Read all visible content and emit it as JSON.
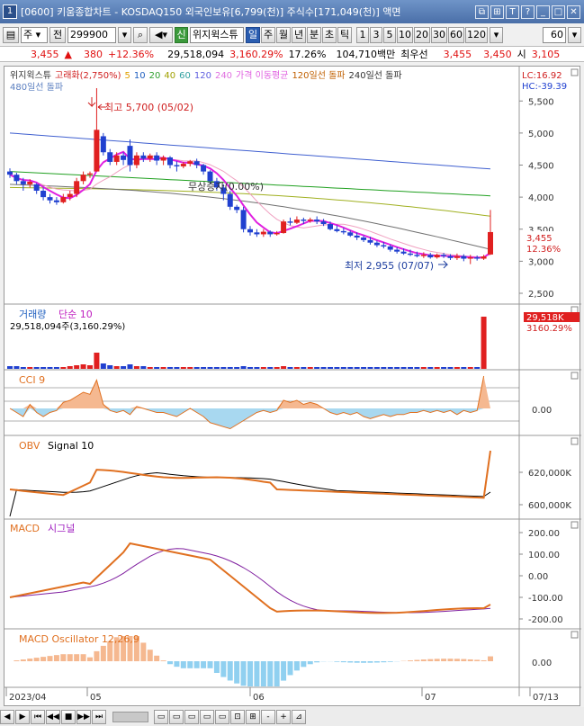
{
  "window": {
    "number": "1",
    "title": "[0600] 키움종합차트 - KOSDAQ150 외국인보유[6,799(천)] 주식수[171,049(천)] 액면",
    "buttons": [
      "⧉",
      "⊞",
      "T",
      "?",
      "_",
      "□",
      "✕"
    ]
  },
  "toolbar": {
    "period_select": "주",
    "prev_btn": "전",
    "code": "299900",
    "signal_label": "위지윅스튜",
    "signal_badge": "신",
    "period_tabs": [
      "일",
      "주",
      "월",
      "년",
      "분",
      "초",
      "틱"
    ],
    "active_tab": "일",
    "minute_values": [
      "1",
      "3",
      "5",
      "10",
      "20",
      "30",
      "60",
      "120"
    ],
    "count_value": "60"
  },
  "quote": {
    "price": "3,455",
    "change": "380",
    "rate": "+12.36%",
    "volume": "29,518,094",
    "vol_ratio": "3,160.29%",
    "turnover": "17.26%",
    "amount": "104,710백만",
    "best_bid_label": "최우선",
    "best_bid": "3,455",
    "best_ask": "3,450",
    "open_label": "시",
    "open": "3,105"
  },
  "price_panel": {
    "header_items": [
      "위지윅스튜",
      "고래화(2,750%)",
      "5",
      "10",
      "20",
      "40",
      "60",
      "120",
      "240",
      "가격 이동평균",
      "120일선 돌파",
      "240일선 돌파"
    ],
    "header_line2": "480일선 돌파",
    "lc_label": "LC:16.92",
    "hc_label": "HC:-39.39",
    "high_annotation": "최고 5,700 (05/02)",
    "low_annotation": "최저 2,955 (07/07)",
    "event_annotation": "무상증자(0.00%)",
    "current_price_tag": "3,455",
    "current_rate_tag": "12.36%",
    "y_ticks": [
      "5,500",
      "5,000",
      "4,500",
      "4,000",
      "3,500",
      "3,000",
      "2,500"
    ]
  },
  "volume_panel": {
    "title": "거래량",
    "ma_label": "단순 10",
    "value_label": "29,518,094주(3,160.29%)",
    "tag_value": "29,518K",
    "tag_rate": "3160.29%"
  },
  "cci_panel": {
    "title": "CCI 9",
    "zero_label": "0.00"
  },
  "obv_panel": {
    "title": "OBV",
    "signal": "Signal 10",
    "y_ticks": [
      "620,000K",
      "600,000K"
    ]
  },
  "macd_panel": {
    "title": "MACD",
    "signal": "시그널",
    "y_ticks": [
      "200.00",
      "100.00",
      "0.00",
      "-100.00",
      "-200.00"
    ]
  },
  "osc_panel": {
    "title": "MACD Oscillator 12,26,9",
    "zero_label": "0.00"
  },
  "x_axis": {
    "labels": [
      "2023/04",
      "05",
      "06",
      "07",
      "07/13"
    ]
  },
  "bottom": {
    "buttons": [
      "◀",
      "▶",
      "⏮",
      "◀◀",
      "■",
      "▶▶",
      "⏭",
      "▭",
      "▭",
      "▭",
      "▭",
      "▭",
      "⊡",
      "⊞",
      "-",
      "+",
      "⊿"
    ]
  },
  "chart_data": {
    "type": "candlestick",
    "x_range": [
      "2023/04",
      "07/13"
    ],
    "y_range": [
      2500,
      5700
    ],
    "candles": [
      {
        "o": 4400,
        "h": 4450,
        "c": 4350,
        "l": 4300
      },
      {
        "o": 4350,
        "h": 4380,
        "c": 4250,
        "l": 4200
      },
      {
        "o": 4250,
        "h": 4300,
        "c": 4200,
        "l": 4100
      },
      {
        "o": 4200,
        "h": 4280,
        "c": 4240,
        "l": 4150
      },
      {
        "o": 4200,
        "h": 4220,
        "c": 4100,
        "l": 4050
      },
      {
        "o": 4100,
        "h": 4150,
        "c": 4000,
        "l": 3950
      },
      {
        "o": 4000,
        "h": 4050,
        "c": 3950,
        "l": 3900
      },
      {
        "o": 3950,
        "h": 4000,
        "c": 3920,
        "l": 3880
      },
      {
        "o": 3920,
        "h": 4050,
        "c": 4000,
        "l": 3900
      },
      {
        "o": 4000,
        "h": 4100,
        "c": 4050,
        "l": 3950
      },
      {
        "o": 4050,
        "h": 4300,
        "c": 4250,
        "l": 4000
      },
      {
        "o": 4250,
        "h": 4400,
        "c": 4350,
        "l": 4200
      },
      {
        "o": 4350,
        "h": 4400,
        "c": 4370,
        "l": 4300
      },
      {
        "o": 4400,
        "h": 5700,
        "c": 5050,
        "l": 4400
      },
      {
        "o": 4950,
        "h": 5000,
        "c": 4700,
        "l": 4650
      },
      {
        "o": 4700,
        "h": 4750,
        "c": 4550,
        "l": 4500
      },
      {
        "o": 4550,
        "h": 4700,
        "c": 4650,
        "l": 4500
      },
      {
        "o": 4650,
        "h": 4700,
        "c": 4580,
        "l": 4500
      },
      {
        "o": 4800,
        "h": 4900,
        "c": 4500,
        "l": 4400
      },
      {
        "o": 4500,
        "h": 4700,
        "c": 4650,
        "l": 4450
      },
      {
        "o": 4650,
        "h": 4700,
        "c": 4600,
        "l": 4550
      },
      {
        "o": 4600,
        "h": 4680,
        "c": 4650,
        "l": 4550
      },
      {
        "o": 4650,
        "h": 4700,
        "c": 4570,
        "l": 4500
      },
      {
        "o": 4570,
        "h": 4650,
        "c": 4620,
        "l": 4500
      },
      {
        "o": 4620,
        "h": 4640,
        "c": 4500,
        "l": 4450
      },
      {
        "o": 4500,
        "h": 4560,
        "c": 4480,
        "l": 4400
      },
      {
        "o": 4480,
        "h": 4550,
        "c": 4520,
        "l": 4450
      },
      {
        "o": 4520,
        "h": 4580,
        "c": 4560,
        "l": 4480
      },
      {
        "o": 4560,
        "h": 4600,
        "c": 4500,
        "l": 4450
      },
      {
        "o": 4500,
        "h": 4520,
        "c": 4400,
        "l": 4350
      },
      {
        "o": 4400,
        "h": 4420,
        "c": 4250,
        "l": 4200
      },
      {
        "o": 4250,
        "h": 4300,
        "c": 4150,
        "l": 4100
      },
      {
        "o": 4150,
        "h": 4200,
        "c": 4050,
        "l": 3950
      },
      {
        "o": 4050,
        "h": 4100,
        "c": 3850,
        "l": 3800
      },
      {
        "o": 3850,
        "h": 3880,
        "c": 3800,
        "l": 3750
      },
      {
        "o": 3800,
        "h": 3850,
        "c": 3500,
        "l": 3450
      },
      {
        "o": 3500,
        "h": 3550,
        "c": 3450,
        "l": 3400
      },
      {
        "o": 3450,
        "h": 3500,
        "c": 3420,
        "l": 3380
      },
      {
        "o": 3420,
        "h": 3500,
        "c": 3460,
        "l": 3380
      },
      {
        "o": 3460,
        "h": 3480,
        "c": 3420,
        "l": 3380
      },
      {
        "o": 3420,
        "h": 3470,
        "c": 3440,
        "l": 3400
      },
      {
        "o": 3440,
        "h": 3650,
        "c": 3620,
        "l": 3430
      },
      {
        "o": 3620,
        "h": 3680,
        "c": 3600,
        "l": 3560
      },
      {
        "o": 3600,
        "h": 3700,
        "c": 3650,
        "l": 3580
      },
      {
        "o": 3650,
        "h": 3680,
        "c": 3630,
        "l": 3580
      },
      {
        "o": 3630,
        "h": 3680,
        "c": 3650,
        "l": 3600
      },
      {
        "o": 3650,
        "h": 3700,
        "c": 3620,
        "l": 3580
      },
      {
        "o": 3620,
        "h": 3660,
        "c": 3580,
        "l": 3550
      },
      {
        "o": 3580,
        "h": 3620,
        "c": 3500,
        "l": 3480
      },
      {
        "o": 3500,
        "h": 3560,
        "c": 3470,
        "l": 3450
      },
      {
        "o": 3470,
        "h": 3520,
        "c": 3450,
        "l": 3420
      },
      {
        "o": 3450,
        "h": 3480,
        "c": 3400,
        "l": 3380
      },
      {
        "o": 3400,
        "h": 3450,
        "c": 3370,
        "l": 3330
      },
      {
        "o": 3370,
        "h": 3400,
        "c": 3330,
        "l": 3300
      },
      {
        "o": 3330,
        "h": 3380,
        "c": 3290,
        "l": 3260
      },
      {
        "o": 3290,
        "h": 3320,
        "c": 3250,
        "l": 3220
      },
      {
        "o": 3250,
        "h": 3300,
        "c": 3230,
        "l": 3200
      },
      {
        "o": 3230,
        "h": 3260,
        "c": 3180,
        "l": 3150
      },
      {
        "o": 3180,
        "h": 3220,
        "c": 3150,
        "l": 3120
      },
      {
        "o": 3150,
        "h": 3200,
        "c": 3120,
        "l": 3100
      },
      {
        "o": 3120,
        "h": 3180,
        "c": 3100,
        "l": 3080
      },
      {
        "o": 3100,
        "h": 3150,
        "c": 3080,
        "l": 3060
      },
      {
        "o": 3080,
        "h": 3140,
        "c": 3100,
        "l": 3050
      },
      {
        "o": 3100,
        "h": 3130,
        "c": 3060,
        "l": 3040
      },
      {
        "o": 3060,
        "h": 3120,
        "c": 3100,
        "l": 3040
      },
      {
        "o": 3100,
        "h": 3130,
        "c": 3080,
        "l": 3050
      },
      {
        "o": 3080,
        "h": 3110,
        "c": 3050,
        "l": 3020
      },
      {
        "o": 3050,
        "h": 3120,
        "c": 3080,
        "l": 3020
      },
      {
        "o": 3080,
        "h": 3110,
        "c": 3040,
        "l": 3000
      },
      {
        "o": 3040,
        "h": 3100,
        "c": 3060,
        "l": 2955
      },
      {
        "o": 3060,
        "h": 3090,
        "c": 3040,
        "l": 3010
      },
      {
        "o": 3040,
        "h": 3100,
        "c": 3075,
        "l": 3020
      },
      {
        "o": 3105,
        "h": 3800,
        "c": 3455,
        "l": 3100
      }
    ]
  }
}
